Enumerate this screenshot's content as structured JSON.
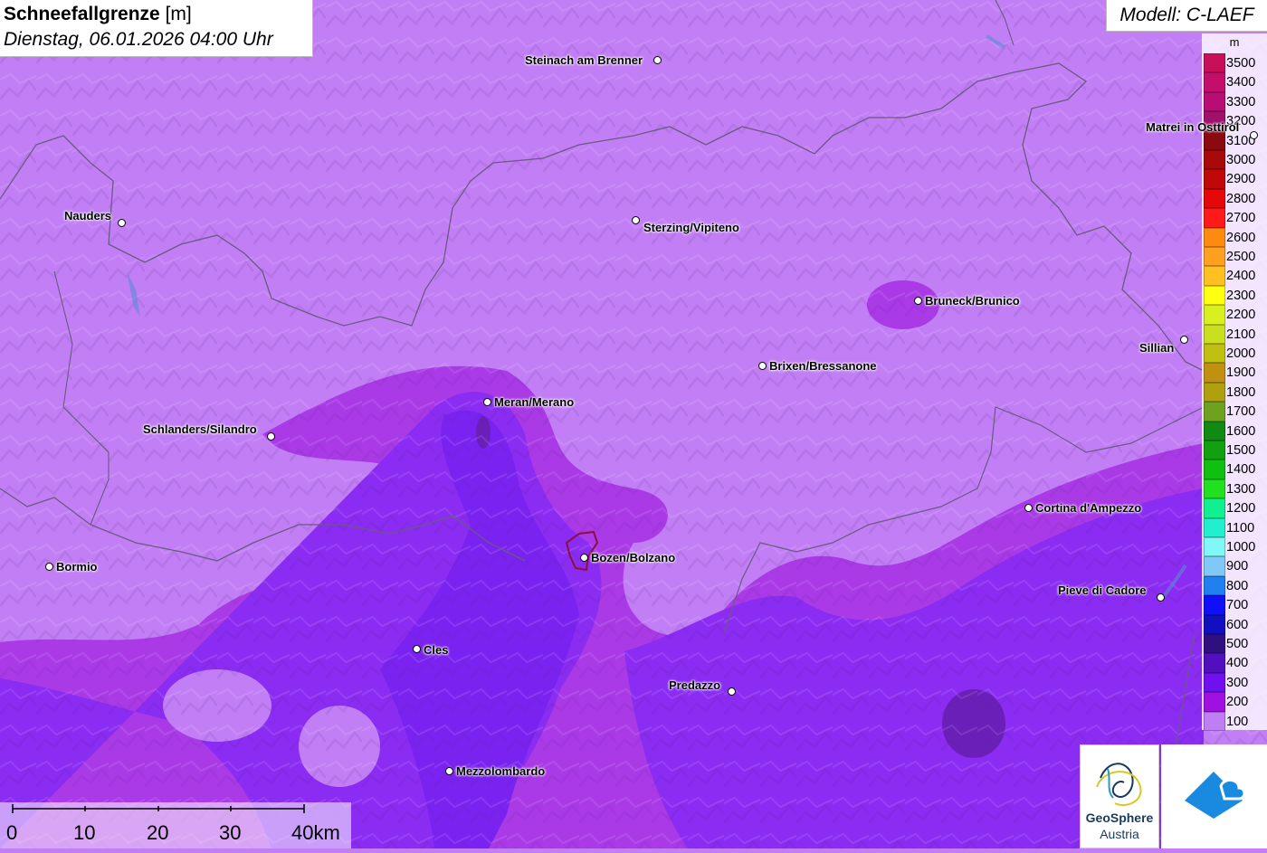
{
  "title": {
    "main": "Schneefallgrenze",
    "unit": "[m]",
    "datetime": "Dienstag, 06.01.2026 04:00 Uhr"
  },
  "model": "Modell: C-LAEF",
  "legend": {
    "unit": "m",
    "levels": [
      {
        "label": "3500",
        "color": "#c8105a"
      },
      {
        "label": "3400",
        "color": "#c40e6c"
      },
      {
        "label": "3300",
        "color": "#b80d74"
      },
      {
        "label": "3200",
        "color": "#a0106c"
      },
      {
        "label": "3100",
        "color": "#8a0a10"
      },
      {
        "label": "3000",
        "color": "#a80a0a"
      },
      {
        "label": "2900",
        "color": "#c00808"
      },
      {
        "label": "2800",
        "color": "#e40808"
      },
      {
        "label": "2700",
        "color": "#ff1a1a"
      },
      {
        "label": "2600",
        "color": "#ff8a10"
      },
      {
        "label": "2500",
        "color": "#ffa020"
      },
      {
        "label": "2400",
        "color": "#ffc020"
      },
      {
        "label": "2300",
        "color": "#ffff10"
      },
      {
        "label": "2200",
        "color": "#d8f020"
      },
      {
        "label": "2100",
        "color": "#c8e020"
      },
      {
        "label": "2000",
        "color": "#c0c010"
      },
      {
        "label": "1900",
        "color": "#c09010"
      },
      {
        "label": "1800",
        "color": "#b0a010"
      },
      {
        "label": "1700",
        "color": "#70a020"
      },
      {
        "label": "1600",
        "color": "#108a10"
      },
      {
        "label": "1500",
        "color": "#10a010"
      },
      {
        "label": "1400",
        "color": "#10c010"
      },
      {
        "label": "1300",
        "color": "#20e020"
      },
      {
        "label": "1200",
        "color": "#10f090"
      },
      {
        "label": "1100",
        "color": "#20f0d0"
      },
      {
        "label": "1000",
        "color": "#80f8f8"
      },
      {
        "label": "900",
        "color": "#80c8f8"
      },
      {
        "label": "800",
        "color": "#2080f0"
      },
      {
        "label": "700",
        "color": "#1010f8"
      },
      {
        "label": "600",
        "color": "#1010c0"
      },
      {
        "label": "500",
        "color": "#301080"
      },
      {
        "label": "400",
        "color": "#5010c0"
      },
      {
        "label": "300",
        "color": "#7010f0"
      },
      {
        "label": "200",
        "color": "#a010e0"
      },
      {
        "label": "100",
        "color": "#c07ef5"
      }
    ]
  },
  "places": [
    {
      "name": "Steinach am Brenner"
    },
    {
      "name": "Nauders"
    },
    {
      "name": "Sterzing/Vipiteno"
    },
    {
      "name": "Matrei in Osttirol"
    },
    {
      "name": "Bruneck/Brunico"
    },
    {
      "name": "Sillian"
    },
    {
      "name": "Brixen/Bressanone"
    },
    {
      "name": "Meran/Merano"
    },
    {
      "name": "Schlanders/Silandro"
    },
    {
      "name": "Cortina d'Ampezzo"
    },
    {
      "name": "Bormio"
    },
    {
      "name": "Bozen/Bolzano"
    },
    {
      "name": "Pieve di Cadore"
    },
    {
      "name": "Cles"
    },
    {
      "name": "Predazzo"
    },
    {
      "name": "Mezzolombardo"
    }
  ],
  "scalebar": {
    "ticks": [
      "0",
      "10",
      "20",
      "30",
      "40km"
    ]
  },
  "logos": {
    "geosphere": [
      "GeoSphere",
      "Austria"
    ]
  },
  "colors": {
    "band_100": "#c27ff5",
    "band_200": "#a020e8",
    "band_300": "#7c1af0",
    "band_400": "#6018d0"
  }
}
